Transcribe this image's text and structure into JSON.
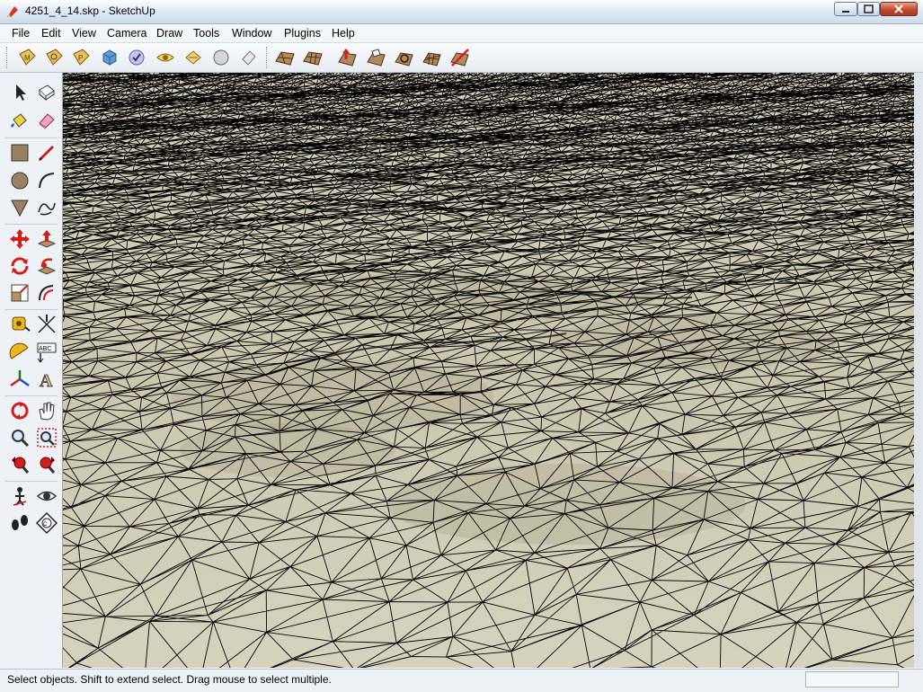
{
  "window": {
    "title": "4251_4_14.skp - SketchUp",
    "controls": [
      "minimize",
      "maximize",
      "close"
    ]
  },
  "menubar": {
    "items": [
      {
        "label": "File",
        "id": "file"
      },
      {
        "label": "Edit",
        "id": "edit"
      },
      {
        "label": "View",
        "id": "view"
      },
      {
        "label": "Camera",
        "id": "camera"
      },
      {
        "label": "Draw",
        "id": "draw"
      },
      {
        "label": "Tools",
        "id": "tools"
      },
      {
        "label": "Window",
        "id": "window"
      },
      {
        "label": "Plugins",
        "id": "plugins"
      },
      {
        "label": "Help",
        "id": "help"
      }
    ]
  },
  "toolbar": {
    "items": [
      "make-component-icon",
      "follow-me-icon",
      "paint-bucket-icon",
      "box-icon",
      "sphere-check-icon",
      "hide-icon",
      "explode-icon",
      "circle-icon",
      "eraser-shape-icon",
      "sandbox-from-contours-icon",
      "sandbox-from-scratch-icon",
      "smoove-icon",
      "stamp-icon",
      "drape-icon",
      "add-detail-icon",
      "flip-edge-icon"
    ]
  },
  "sidebar": {
    "tools": [
      "select-icon",
      "make-component-icon",
      "paint-bucket-icon",
      "eraser-icon",
      "rectangle-icon",
      "line-icon",
      "circle-icon",
      "arc-icon",
      "polygon-icon",
      "freehand-icon",
      "move-icon",
      "push-pull-icon",
      "rotate-icon",
      "follow-me-icon",
      "scale-icon",
      "offset-icon",
      "tape-measure-icon",
      "dimension-icon",
      "protractor-icon",
      "text-icon",
      "axes-icon",
      "3d-text-icon",
      "orbit-icon",
      "pan-icon",
      "zoom-icon",
      "zoom-window-icon",
      "previous-view-icon",
      "next-view-icon",
      "position-camera-icon",
      "look-around-icon",
      "walk-icon",
      "section-plane-icon"
    ]
  },
  "viewport": {
    "description_colors": {
      "surface": "#d0ccb5",
      "edges": "#000000"
    }
  },
  "statusbar": {
    "text": "Select objects. Shift to extend select. Drag mouse to select multiple.",
    "measurements_value": ""
  }
}
